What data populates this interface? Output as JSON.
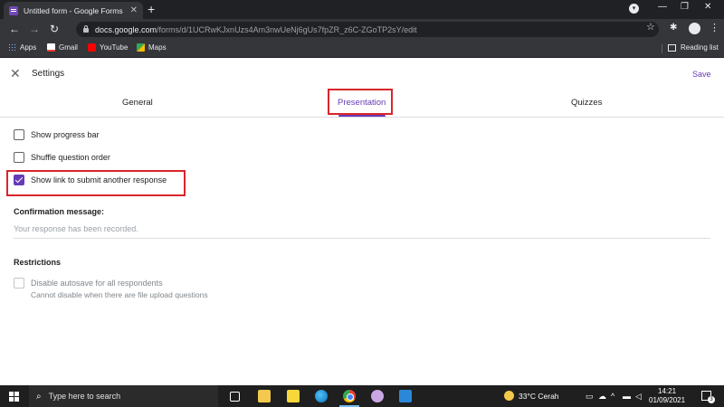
{
  "browser": {
    "tab_title": "Untitled form - Google Forms",
    "url_host": "docs.google.com",
    "url_path": "/forms/d/1UCRwKJxnUzs4Am3nwUeNj6gUs7fpZR_z6C-ZGoTP2sY/edit",
    "bookmarks": [
      "Apps",
      "Gmail",
      "YouTube",
      "Maps"
    ],
    "reading_list": "Reading list"
  },
  "settings": {
    "title": "Settings",
    "save_label": "Save",
    "tabs": [
      "General",
      "Presentation",
      "Quizzes"
    ],
    "active_tab": "Presentation",
    "options": [
      {
        "label": "Show progress bar",
        "checked": false
      },
      {
        "label": "Shuffle question order",
        "checked": false
      },
      {
        "label": "Show link to submit another response",
        "checked": true
      }
    ],
    "confirmation_label": "Confirmation message:",
    "confirmation_value": "Your response has been recorded.",
    "restrictions_label": "Restrictions",
    "autosave_label": "Disable autosave for all respondents",
    "autosave_note": "Cannot disable when there are file upload questions",
    "accent_color": "#673ab7",
    "highlight_color": "#d9252a"
  },
  "taskbar": {
    "search_placeholder": "Type here to search",
    "weather_temp": "33°C",
    "weather_desc": "Cerah",
    "time": "14:21",
    "date": "01/09/2021",
    "notification_count": "3"
  }
}
